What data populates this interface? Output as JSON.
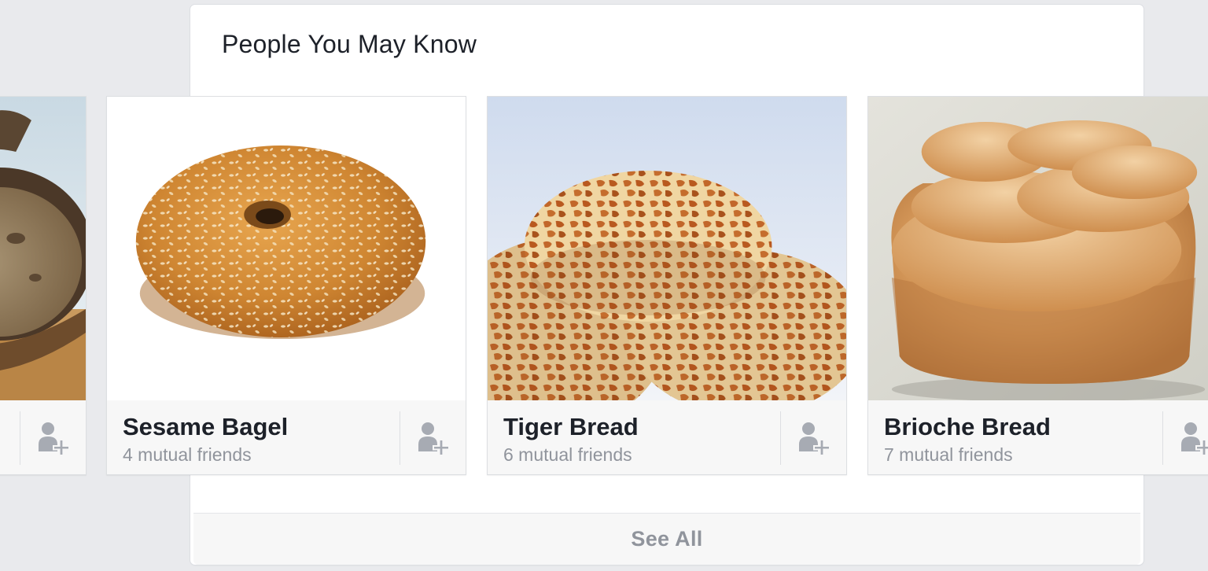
{
  "section": {
    "title": "People You May Know",
    "see_all_label": "See All"
  },
  "icons": {
    "add_friend": "add-friend-icon"
  },
  "colors": {
    "background": "#e9eaed",
    "card_info": "#f7f7f7",
    "name_text": "#1d2129",
    "secondary_text": "#90949c",
    "icon": "#a7abb3"
  },
  "suggestions": [
    {
      "name": "",
      "mutual": ""
    },
    {
      "name": "Sesame Bagel",
      "mutual": "4 mutual friends"
    },
    {
      "name": "Tiger Bread",
      "mutual": "6 mutual friends"
    },
    {
      "name": "Brioche Bread",
      "mutual": "7 mutual friends"
    }
  ]
}
